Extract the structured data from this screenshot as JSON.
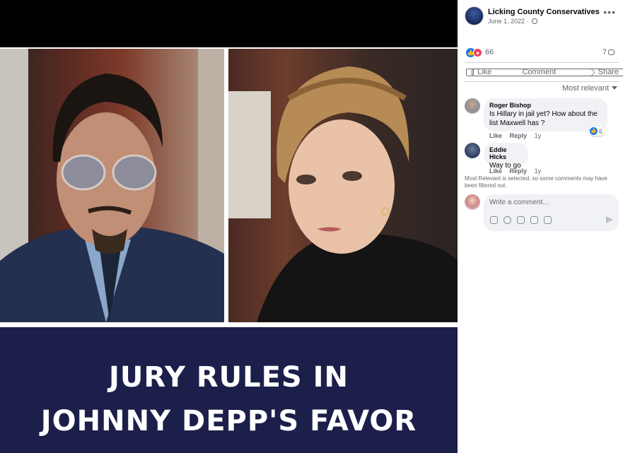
{
  "post": {
    "image_caption": {
      "line1": "JURY RULES IN",
      "line2": "JOHNNY DEPP'S FAVOR"
    }
  },
  "page": {
    "name": "Licking County Conservatives",
    "date": "June 1, 2022 ·",
    "more_icon": "more-horizontal-icon"
  },
  "reactions": {
    "count": "66",
    "comments_count": "7"
  },
  "actions": {
    "like": "Like",
    "comment": "Comment",
    "share": "Share"
  },
  "sort": {
    "label": "Most relevant"
  },
  "comments": [
    {
      "name": "Roger Bishop",
      "text": "Is Hillary in jail yet? How about the list Maxwell has ?",
      "like": "Like",
      "reply": "Reply",
      "time": "1y",
      "reaction_count": "6"
    },
    {
      "name": "Eddie Hicks",
      "text": "Way to go",
      "like": "Like",
      "reply": "Reply",
      "time": "1y"
    }
  ],
  "filter_note": "Most Relevant is selected, so some comments may have been filtered out.",
  "composer": {
    "placeholder": "Write a comment..."
  },
  "colors": {
    "caption_band": "#1b1f4a",
    "facebook_blue": "#1877f2",
    "love_red": "#f33e58",
    "secondary_text": "#65676b",
    "bubble_bg": "#f0f2f5"
  }
}
